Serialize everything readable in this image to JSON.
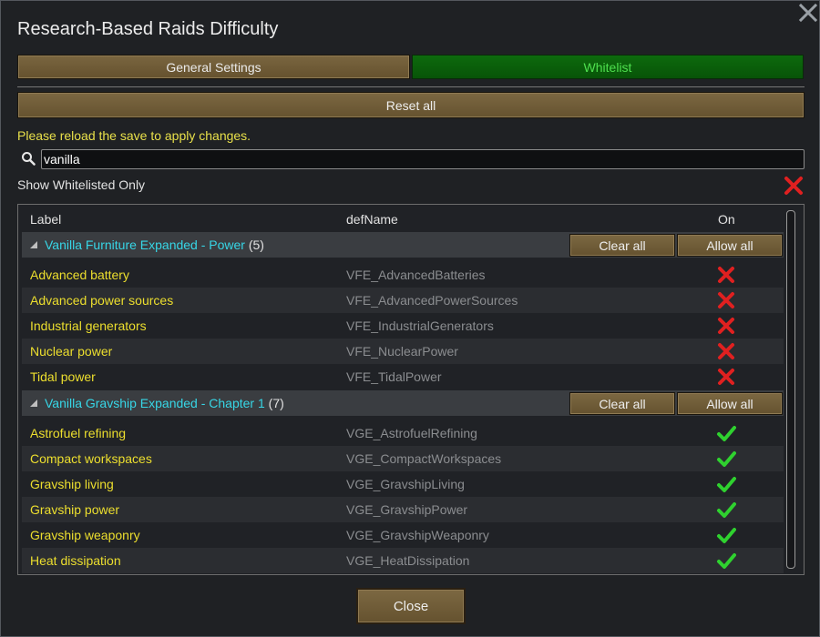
{
  "window": {
    "title": "Research-Based Raids Difficulty",
    "close_icon": "close-icon"
  },
  "tabs": [
    {
      "label": "General Settings",
      "active": false
    },
    {
      "label": "Whitelist",
      "active": true
    }
  ],
  "reset_all_label": "Reset all",
  "notice": "Please reload the save to apply changes.",
  "search": {
    "value": "vanilla",
    "placeholder": "",
    "icon": "search-icon"
  },
  "show_whitelisted": {
    "label": "Show Whitelisted Only",
    "checked": false
  },
  "table": {
    "headers": {
      "label": "Label",
      "defname": "defName",
      "on": "On"
    },
    "groups": [
      {
        "name": "Vanilla Furniture Expanded - Power",
        "count": "(5)",
        "clear_label": "Clear all",
        "allow_label": "Allow all",
        "rows": [
          {
            "label": "Advanced battery",
            "def": "VFE_AdvancedBatteries",
            "on": false
          },
          {
            "label": "Advanced power sources",
            "def": "VFE_AdvancedPowerSources",
            "on": false
          },
          {
            "label": "Industrial generators",
            "def": "VFE_IndustrialGenerators",
            "on": false
          },
          {
            "label": "Nuclear power",
            "def": "VFE_NuclearPower",
            "on": false
          },
          {
            "label": "Tidal power",
            "def": "VFE_TidalPower",
            "on": false
          }
        ]
      },
      {
        "name": "Vanilla Gravship Expanded - Chapter 1",
        "count": "(7)",
        "clear_label": "Clear all",
        "allow_label": "Allow all",
        "rows": [
          {
            "label": "Astrofuel refining",
            "def": "VGE_AstrofuelRefining",
            "on": true
          },
          {
            "label": "Compact workspaces",
            "def": "VGE_CompactWorkspaces",
            "on": true
          },
          {
            "label": "Gravship living",
            "def": "VGE_GravshipLiving",
            "on": true
          },
          {
            "label": "Gravship power",
            "def": "VGE_GravshipPower",
            "on": true
          },
          {
            "label": "Gravship weaponry",
            "def": "VGE_GravshipWeaponry",
            "on": true
          },
          {
            "label": "Heat dissipation",
            "def": "VGE_HeatDissipation",
            "on": true
          }
        ]
      }
    ]
  },
  "close_label": "Close",
  "colors": {
    "accent_group": "#37d6e6",
    "label_yellow": "#eddf2e",
    "active_tab": "#0d6a0d",
    "button_brown": "#7c6842",
    "check_green": "#2fd12f",
    "cross_red": "#e02020"
  }
}
